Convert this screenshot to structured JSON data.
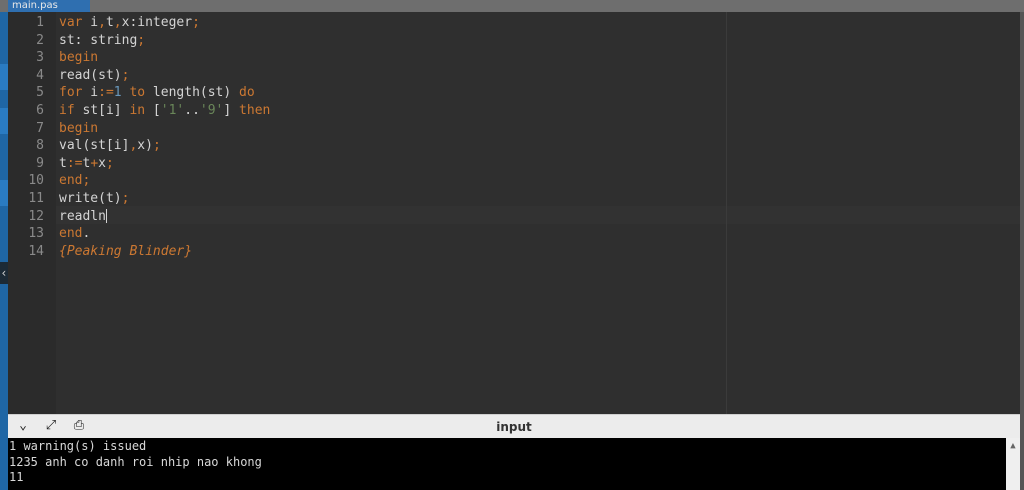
{
  "tab": {
    "title": "main.pas"
  },
  "editor": {
    "lines": [
      {
        "n": "1",
        "parts": [
          {
            "t": "var",
            "c": "kw"
          },
          {
            "t": " i",
            "c": ""
          },
          {
            "t": ",",
            "c": "kw"
          },
          {
            "t": "t",
            "c": ""
          },
          {
            "t": ",",
            "c": "kw"
          },
          {
            "t": "x:integer",
            "c": ""
          },
          {
            "t": ";",
            "c": "kw"
          }
        ]
      },
      {
        "n": "2",
        "parts": [
          {
            "t": "st: string",
            "c": ""
          },
          {
            "t": ";",
            "c": "kw"
          }
        ]
      },
      {
        "n": "3",
        "parts": [
          {
            "t": "begin",
            "c": "kw"
          }
        ]
      },
      {
        "n": "4",
        "parts": [
          {
            "t": "read(st)",
            "c": ""
          },
          {
            "t": ";",
            "c": "kw"
          }
        ]
      },
      {
        "n": "5",
        "parts": [
          {
            "t": "for",
            "c": "kw"
          },
          {
            "t": " i",
            "c": ""
          },
          {
            "t": ":=",
            "c": "kw"
          },
          {
            "t": "1",
            "c": "num"
          },
          {
            "t": " ",
            "c": ""
          },
          {
            "t": "to",
            "c": "kw"
          },
          {
            "t": " length(st) ",
            "c": ""
          },
          {
            "t": "do",
            "c": "kw"
          }
        ]
      },
      {
        "n": "6",
        "parts": [
          {
            "t": "if",
            "c": "kw"
          },
          {
            "t": " st[i] ",
            "c": ""
          },
          {
            "t": "in",
            "c": "kw"
          },
          {
            "t": " [",
            "c": ""
          },
          {
            "t": "'1'",
            "c": "str"
          },
          {
            "t": "..",
            "c": ""
          },
          {
            "t": "'9'",
            "c": "str"
          },
          {
            "t": "] ",
            "c": ""
          },
          {
            "t": "then",
            "c": "kw"
          }
        ]
      },
      {
        "n": "7",
        "parts": [
          {
            "t": "begin",
            "c": "kw"
          }
        ]
      },
      {
        "n": "8",
        "parts": [
          {
            "t": "val(st[i]",
            "c": ""
          },
          {
            "t": ",",
            "c": "kw"
          },
          {
            "t": "x)",
            "c": ""
          },
          {
            "t": ";",
            "c": "kw"
          }
        ]
      },
      {
        "n": "9",
        "parts": [
          {
            "t": "t",
            "c": ""
          },
          {
            "t": ":=",
            "c": "kw"
          },
          {
            "t": "t",
            "c": ""
          },
          {
            "t": "+",
            "c": "kw"
          },
          {
            "t": "x",
            "c": ""
          },
          {
            "t": ";",
            "c": "kw"
          }
        ]
      },
      {
        "n": "10",
        "parts": [
          {
            "t": "end",
            "c": "kw"
          },
          {
            "t": ";",
            "c": "kw"
          }
        ]
      },
      {
        "n": "11",
        "parts": [
          {
            "t": "write(t)",
            "c": ""
          },
          {
            "t": ";",
            "c": "kw"
          }
        ]
      },
      {
        "n": "12",
        "parts": [
          {
            "t": "readln",
            "c": ""
          }
        ],
        "caret": true
      },
      {
        "n": "13",
        "parts": [
          {
            "t": "end",
            "c": "kw"
          },
          {
            "t": ".",
            "c": ""
          }
        ]
      },
      {
        "n": "14",
        "parts": [
          {
            "t": "{Peaking Blinder}",
            "c": "cmt"
          }
        ]
      }
    ]
  },
  "panel": {
    "title": "input",
    "buttons": [
      "chevron-down-icon",
      "expand-icon",
      "print-icon"
    ],
    "output": [
      "1 warning(s) issued",
      "1235 anh co danh roi nhip nao khong",
      "11"
    ]
  },
  "colors": {
    "keyword": "#cc7832",
    "number": "#6897bb",
    "string": "#6a8759",
    "text": "#d4d4d4",
    "editor_bg": "#2f2f2f",
    "console_bg": "#000000"
  }
}
